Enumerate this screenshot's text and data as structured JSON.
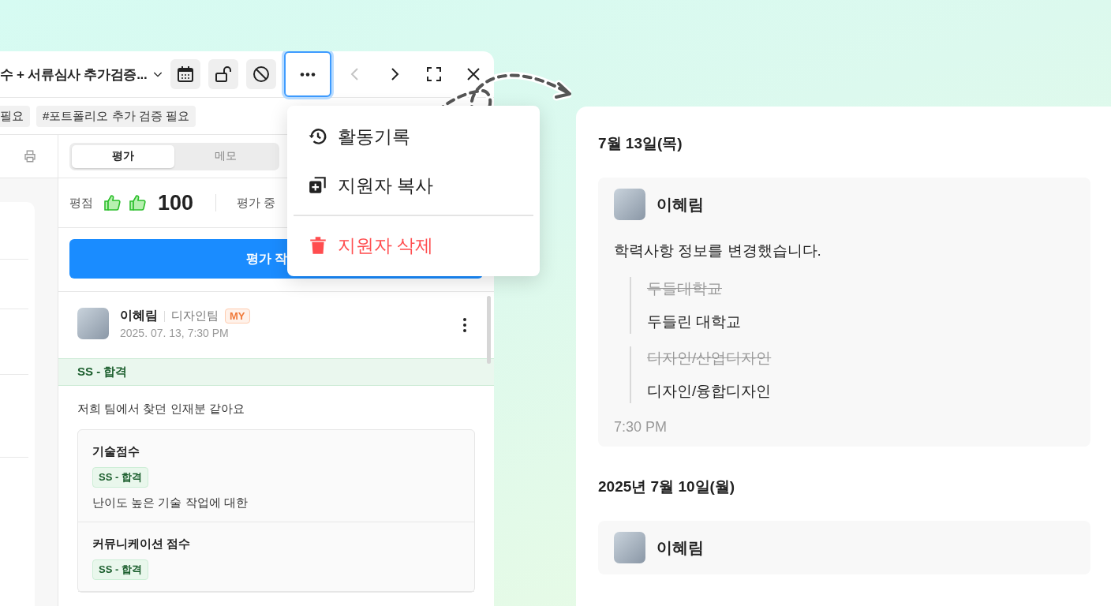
{
  "left_window": {
    "title": "수 + 서류심사 추가검증...",
    "toolbar": [
      {
        "kind": "calendar",
        "selected": false,
        "disabled": false
      },
      {
        "kind": "unlock",
        "selected": false,
        "disabled": false
      },
      {
        "kind": "block",
        "selected": false,
        "disabled": false
      },
      {
        "kind": "more",
        "selected": true,
        "disabled": false
      },
      {
        "kind": "prev",
        "selected": false,
        "disabled": true
      },
      {
        "kind": "next",
        "selected": false,
        "disabled": false
      },
      {
        "kind": "fullscreen",
        "selected": false,
        "disabled": false
      },
      {
        "kind": "close",
        "selected": false,
        "disabled": false
      }
    ],
    "tags": [
      "필요",
      "#포트폴리오 추가 검증 필요"
    ],
    "tabs": [
      {
        "label": "평가",
        "selected": true
      },
      {
        "label": "메모",
        "selected": false
      }
    ],
    "score": {
      "label": "평점",
      "icons": [
        {
          "kind": "thumb"
        },
        {
          "kind": "thumb"
        }
      ],
      "value": "100",
      "status": "평가 중"
    },
    "write_button": "평가 작",
    "comment": {
      "author": "이혜림",
      "team": "디자인팀",
      "badge": "MY",
      "date": "2025. 07. 13, 7:30 PM",
      "grade": "SS - 합격",
      "text": "저희 팀에서 찾던 인재분 같아요",
      "scores": [
        {
          "title": "기술점수",
          "grade": "SS - 합격",
          "text": "난이도 높은 기술 작업에 대한"
        },
        {
          "title": "커뮤니케이션 점수",
          "grade": "SS - 합격"
        }
      ]
    }
  },
  "menu": {
    "groups": [
      [
        {
          "kind": "history",
          "label": "활동기록"
        },
        {
          "kind": "copy",
          "label": "지원자 복사"
        }
      ],
      [
        {
          "kind": "delete",
          "label": "지원자 삭제"
        }
      ]
    ]
  },
  "activity": {
    "days": [
      {
        "date": "7월 13일(목)",
        "entries": [
          {
            "author": "이혜림",
            "message": "학력사항 정보를 변경했습니다.",
            "changes": [
              {
                "before": "두들대학교",
                "after": "두들린 대학교"
              },
              {
                "before": "디자인/산업디자인",
                "after": "디자인/융합디자인"
              }
            ],
            "time": "7:30 PM"
          }
        ]
      },
      {
        "date": "2025년 7월 10일(월)",
        "entries": [
          {
            "author": "이혜림"
          }
        ]
      }
    ]
  }
}
